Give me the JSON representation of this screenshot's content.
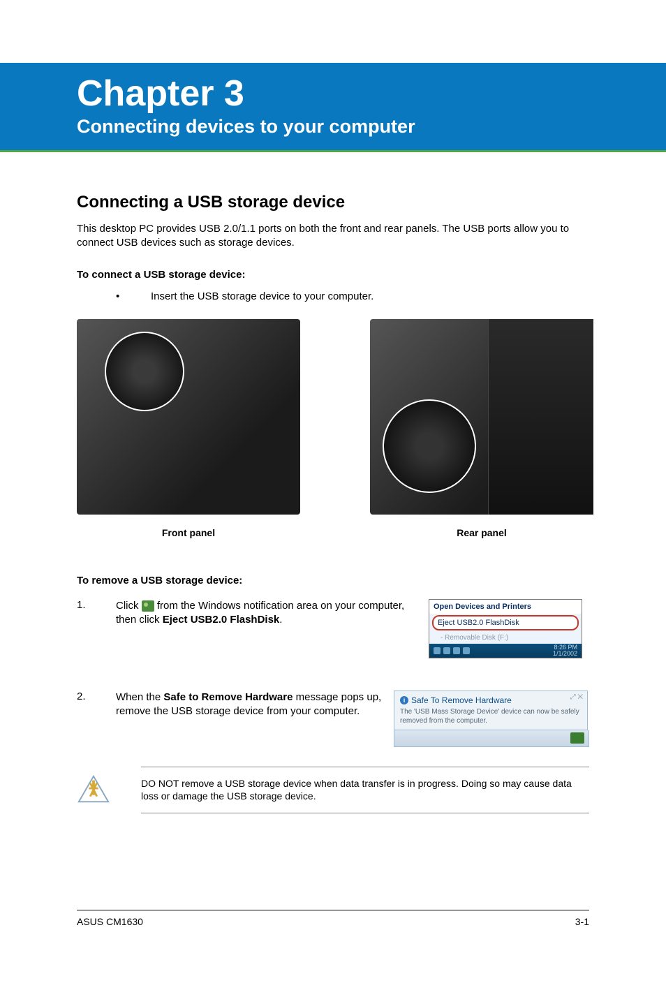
{
  "banner": {
    "chapter": "Chapter 3",
    "title": "Connecting devices to your computer"
  },
  "section": {
    "heading": "Connecting a USB storage device",
    "intro": "This desktop PC provides USB 2.0/1.1 ports on both the front and rear panels. The USB ports allow you to connect USB devices such as storage devices."
  },
  "connect": {
    "heading": "To connect a USB storage device:",
    "bullet": "Insert the USB storage device to your computer.",
    "front_caption": "Front panel",
    "rear_caption": "Rear panel"
  },
  "remove": {
    "heading": "To remove a USB storage device:",
    "step1_num": "1.",
    "step1_a": "Click ",
    "step1_b": " from the Windows notification area on your computer, then click ",
    "step1_bold": "Eject USB2.0 FlashDisk",
    "step1_end": ".",
    "step2_num": "2.",
    "step2_a": "When the ",
    "step2_bold": "Safe to Remove Hardware",
    "step2_b": " message pops up, remove the USB storage device from your computer."
  },
  "popup1": {
    "row1": "Open Devices and Printers",
    "row2": "Eject USB2.0 FlashDisk",
    "row3": "- Removable Disk (F:)",
    "time": "8:26 PM",
    "date": "1/1/2002"
  },
  "popup2": {
    "title": "Safe To Remove Hardware",
    "body": "The 'USB Mass Storage Device' device can now be safely removed from the computer."
  },
  "warning": {
    "text": "DO NOT remove a USB storage device when data transfer is in progress. Doing so may cause data loss or damage the USB storage device."
  },
  "footer": {
    "left": "ASUS CM1630",
    "right": "3-1"
  }
}
